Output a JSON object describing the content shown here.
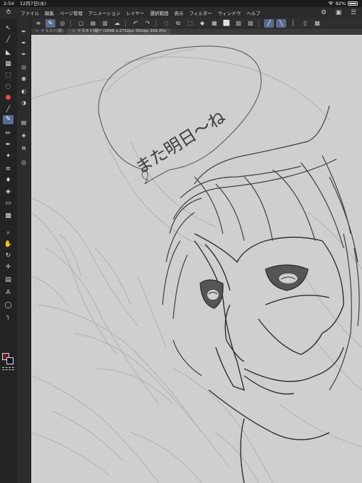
{
  "status": {
    "time": "2:54",
    "date": "12月7日(水)",
    "battery": "92%"
  },
  "menu": {
    "items": [
      "ファイル",
      "編集",
      "ページ管理",
      "アニメーション",
      "レイヤー",
      "選択範囲",
      "表示",
      "フィルター",
      "ウィンドウ",
      "ヘルプ"
    ]
  },
  "tabs": [
    {
      "label": "イラスト(縦)",
      "active": false
    },
    {
      "label": "イラスト(縦)* (2048 x 2732px 350dpi 209.3%)",
      "active": true
    }
  ],
  "canvas": {
    "speech_text": "また明日〜ね"
  },
  "colors": {
    "main": "#6a1e24",
    "sub": "#0e1530",
    "canvas_bg": "#cfcfcf",
    "accent": "#5c6a8c"
  }
}
